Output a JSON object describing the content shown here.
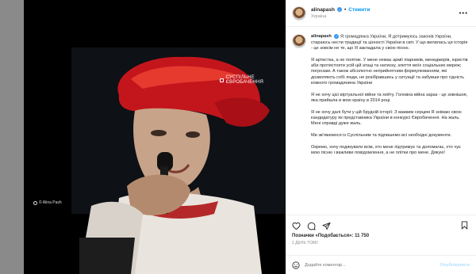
{
  "post": {
    "username": "alinapash",
    "follow_label": "Стежити",
    "location": "Україна",
    "more_label": "•••",
    "broadcast_label": "СУСПІЛЬНЕ ЄВРОБАЧЕННЯ",
    "photo_credit": "© Alina Pash",
    "caption": [
      "Я громадянка України, Я дотримуюсь законів України, стараюсь нести традиції та цінності України в світ. У що вилилась ця історія - це зовсім не те, що Я закладала у свою пісню.",
      "Я артистка, а не політик. У мене немає армії піарників, менеджерів, юристів аби протистояти усій цій атаці та натиску, злиття моїх соціальних мереж; погрозам. А також абсолютно неприйнятним формулюванням, які дозволяють собі люди, не розібравшись у ситуації та забувши про гідність кожного громадянина України",
      "Я не хочу цієї віртуальної війни та хейту. Головна війна зараз - це зовнішня, яка прийшла в мою країну в 2014 році.",
      "Я не хочу далі бути у цій брудній історії: З важким серцем Я знімаю свою кандидатуру як представника України в конкурсі Євробачення. На жаль. Мені справді дуже жаль.",
      "Ми зв'яжемося із Суспільним та підпишемо всі необхідні документи.",
      "Окремо, хочу подякувати всім, хто мене підтримує та допомагає, хто чує мою пісню і важливе повідомлення, а не плітки про мене. Дякую!"
    ],
    "likes_label": "Позначки «Подобається»: 11 750",
    "time_label": "1 ДЕНЬ ТОМУ",
    "comment_placeholder": "Додайте коментар...",
    "publish_label": "Опублікувати"
  },
  "icons": {
    "like": "heart-icon",
    "comment": "comment-icon",
    "share": "share-icon",
    "save": "bookmark-icon",
    "emoji": "emoji-icon",
    "verified": "verified-icon"
  }
}
